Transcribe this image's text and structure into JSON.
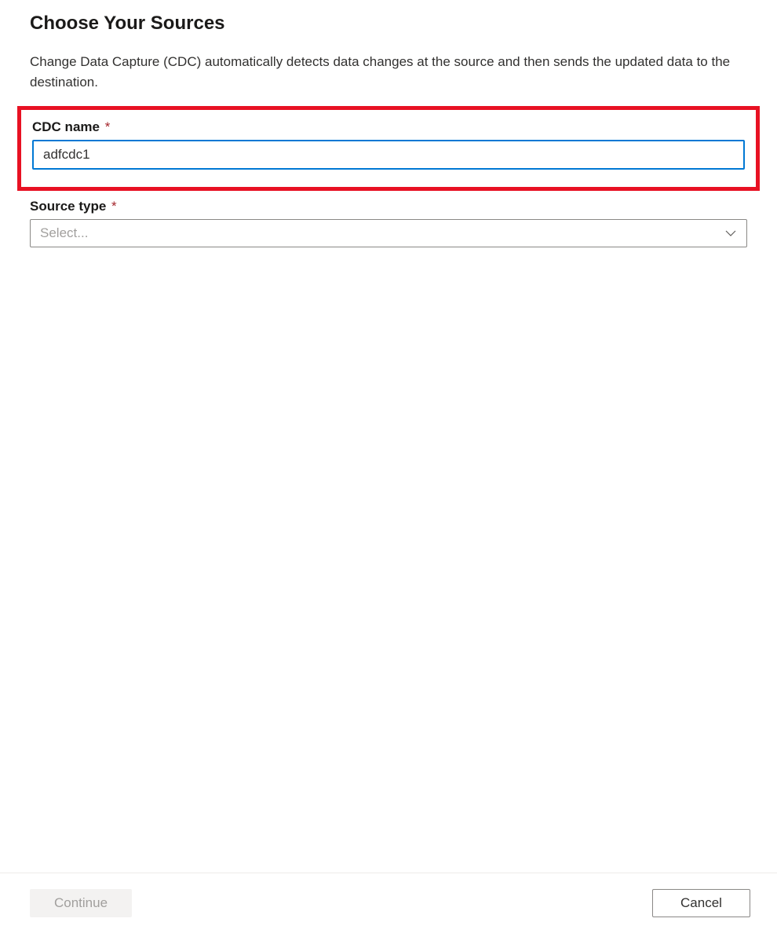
{
  "header": {
    "title": "Choose Your Sources",
    "description": "Change Data Capture (CDC) automatically detects data changes at the source and then sends the updated data to the destination."
  },
  "form": {
    "cdc_name": {
      "label": "CDC name",
      "required_marker": "*",
      "value": "adfcdc1"
    },
    "source_type": {
      "label": "Source type",
      "required_marker": "*",
      "placeholder": "Select..."
    }
  },
  "footer": {
    "continue_label": "Continue",
    "cancel_label": "Cancel"
  }
}
